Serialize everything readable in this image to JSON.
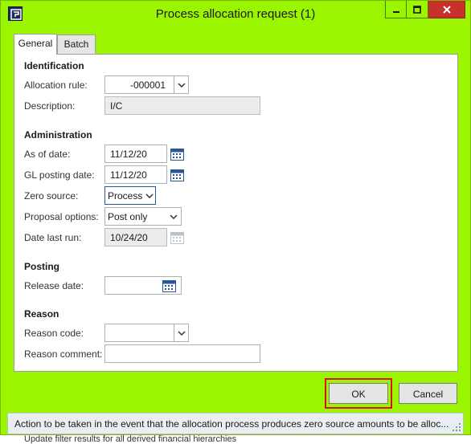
{
  "window": {
    "title": "Process allocation request (1)"
  },
  "tabs": [
    {
      "label": "General"
    },
    {
      "label": "Batch"
    }
  ],
  "sections": {
    "identification": "Identification",
    "administration": "Administration",
    "posting": "Posting",
    "reason": "Reason"
  },
  "fields": {
    "allocation_rule": {
      "label": "Allocation rule:",
      "value": "-000001"
    },
    "description": {
      "label": "Description:",
      "value": "I/C"
    },
    "as_of_date": {
      "label": "As of date:",
      "value": "11/12/20"
    },
    "gl_posting_date": {
      "label": "GL posting date:",
      "value": "11/12/20"
    },
    "zero_source": {
      "label": "Zero source:",
      "value": "Process"
    },
    "proposal_options": {
      "label": "Proposal options:",
      "value": "Post only"
    },
    "date_last_run": {
      "label": "Date last run:",
      "value": "10/24/20"
    },
    "release_date": {
      "label": "Release date:",
      "value": ""
    },
    "reason_code": {
      "label": "Reason code:",
      "value": ""
    },
    "reason_comment": {
      "label": "Reason comment:",
      "value": ""
    }
  },
  "buttons": {
    "ok": "OK",
    "cancel": "Cancel"
  },
  "status_text": "Action to be taken in the event that the allocation process produces zero source amounts to be alloc...",
  "background_text": "Update filter results for all derived financial hierarchies",
  "colors": {
    "window_bg": "#9cf500",
    "close_button": "#c7302b",
    "highlight": "#d3141a"
  }
}
